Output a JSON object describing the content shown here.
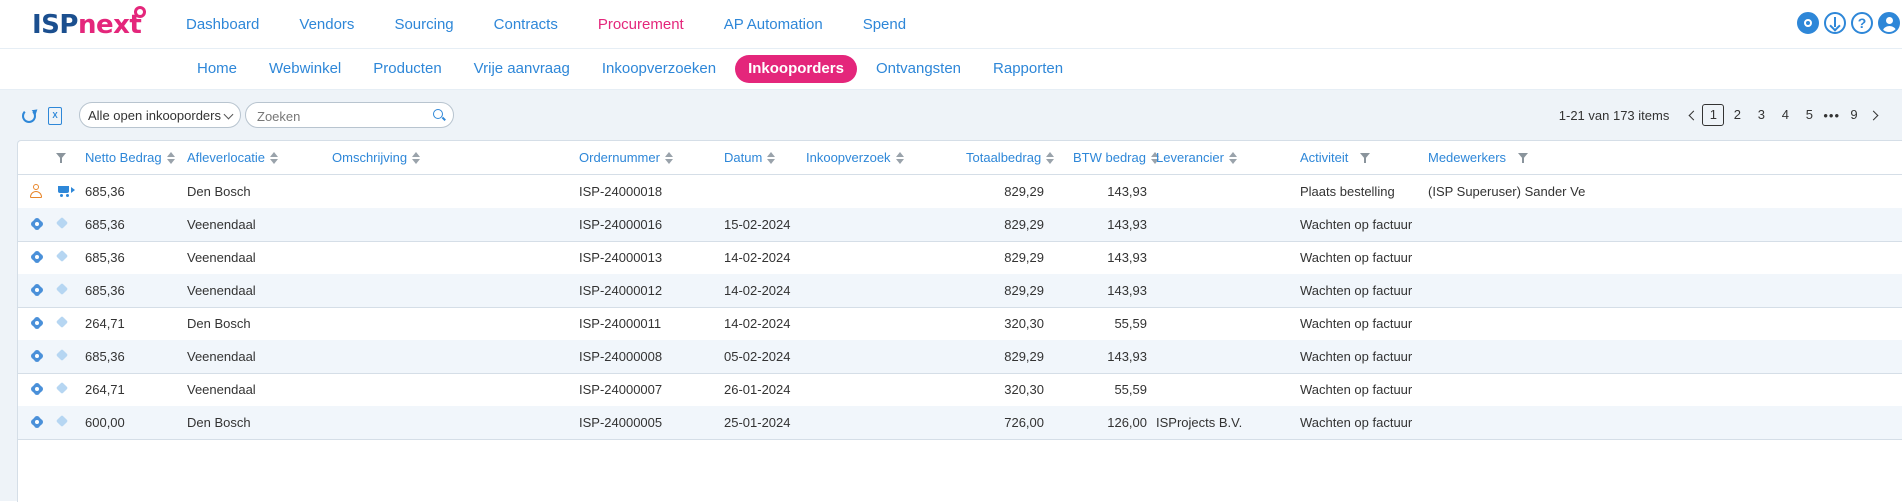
{
  "brand": {
    "logo_part1": "ISP",
    "logo_part2": "next"
  },
  "main_nav": [
    {
      "label": "Dashboard",
      "active": false
    },
    {
      "label": "Vendors",
      "active": false
    },
    {
      "label": "Sourcing",
      "active": false
    },
    {
      "label": "Contracts",
      "active": false
    },
    {
      "label": "Procurement",
      "active": true
    },
    {
      "label": "AP Automation",
      "active": false
    },
    {
      "label": "Spend",
      "active": false
    }
  ],
  "header_icons": [
    "gear-icon",
    "download-icon",
    "help-icon",
    "user-icon"
  ],
  "help_glyph": "?",
  "sub_nav": [
    {
      "label": "Home",
      "active": false
    },
    {
      "label": "Webwinkel",
      "active": false
    },
    {
      "label": "Producten",
      "active": false
    },
    {
      "label": "Vrije aanvraag",
      "active": false
    },
    {
      "label": "Inkoopverzoeken",
      "active": false
    },
    {
      "label": "Inkooporders",
      "active": true
    },
    {
      "label": "Ontvangsten",
      "active": false
    },
    {
      "label": "Rapporten",
      "active": false
    }
  ],
  "toolbar": {
    "excel_glyph": "X",
    "filter_value": "Alle open inkooporders",
    "search_placeholder": "Zoeken"
  },
  "pager": {
    "range_text": "1-21 van 173 items",
    "pages": [
      "1",
      "2",
      "3",
      "4",
      "5"
    ],
    "active_page": "1",
    "ellipsis": "•••",
    "last_page": "9"
  },
  "columns": {
    "netto_bedrag": "Netto Bedrag",
    "afleverlocatie": "Afleverlocatie",
    "omschrijving": "Omschrijving",
    "ordernummer": "Ordernummer",
    "datum": "Datum",
    "inkoopverzoek": "Inkoopverzoek",
    "totaalbedrag": "Totaalbedrag",
    "btw_bedrag": "BTW bedrag",
    "leverancier": "Leverancier",
    "activiteit": "Activiteit",
    "medewerkers": "Medewerkers"
  },
  "rows": [
    {
      "type": "action",
      "netto": "685,36",
      "locatie": "Den Bosch",
      "omschrijving": "",
      "ordernummer": "ISP-24000018",
      "datum": "",
      "inkoopverzoek": "",
      "totaal": "829,29",
      "btw": "143,93",
      "leverancier": "",
      "activiteit": "Plaats bestelling",
      "medewerkers": "(ISP Superuser) Sander Ve"
    },
    {
      "type": "normal",
      "netto": "685,36",
      "locatie": "Veenendaal",
      "omschrijving": "",
      "ordernummer": "ISP-24000016",
      "datum": "15-02-2024",
      "inkoopverzoek": "",
      "totaal": "829,29",
      "btw": "143,93",
      "leverancier": "",
      "activiteit": "Wachten op factuur",
      "medewerkers": ""
    },
    {
      "type": "normal",
      "netto": "685,36",
      "locatie": "Veenendaal",
      "omschrijving": "",
      "ordernummer": "ISP-24000013",
      "datum": "14-02-2024",
      "inkoopverzoek": "",
      "totaal": "829,29",
      "btw": "143,93",
      "leverancier": "",
      "activiteit": "Wachten op factuur",
      "medewerkers": ""
    },
    {
      "type": "normal",
      "netto": "685,36",
      "locatie": "Veenendaal",
      "omschrijving": "",
      "ordernummer": "ISP-24000012",
      "datum": "14-02-2024",
      "inkoopverzoek": "",
      "totaal": "829,29",
      "btw": "143,93",
      "leverancier": "",
      "activiteit": "Wachten op factuur",
      "medewerkers": ""
    },
    {
      "type": "normal",
      "netto": "264,71",
      "locatie": "Den Bosch",
      "omschrijving": "",
      "ordernummer": "ISP-24000011",
      "datum": "14-02-2024",
      "inkoopverzoek": "",
      "totaal": "320,30",
      "btw": "55,59",
      "leverancier": "",
      "activiteit": "Wachten op factuur",
      "medewerkers": ""
    },
    {
      "type": "normal",
      "netto": "685,36",
      "locatie": "Veenendaal",
      "omschrijving": "",
      "ordernummer": "ISP-24000008",
      "datum": "05-02-2024",
      "inkoopverzoek": "",
      "totaal": "829,29",
      "btw": "143,93",
      "leverancier": "",
      "activiteit": "Wachten op factuur",
      "medewerkers": ""
    },
    {
      "type": "normal",
      "netto": "264,71",
      "locatie": "Veenendaal",
      "omschrijving": "",
      "ordernummer": "ISP-24000007",
      "datum": "26-01-2024",
      "inkoopverzoek": "",
      "totaal": "320,30",
      "btw": "55,59",
      "leverancier": "",
      "activiteit": "Wachten op factuur",
      "medewerkers": ""
    },
    {
      "type": "normal",
      "netto": "600,00",
      "locatie": "Den Bosch",
      "omschrijving": "",
      "ordernummer": "ISP-24000005",
      "datum": "25-01-2024",
      "inkoopverzoek": "",
      "totaal": "726,00",
      "btw": "126,00",
      "leverancier": "ISProjects B.V.",
      "activiteit": "Wachten op factuur",
      "medewerkers": ""
    }
  ],
  "colors": {
    "accent": "#2e87d8",
    "brand_pink": "#e4267b",
    "row_alt": "#f1f6fb"
  }
}
